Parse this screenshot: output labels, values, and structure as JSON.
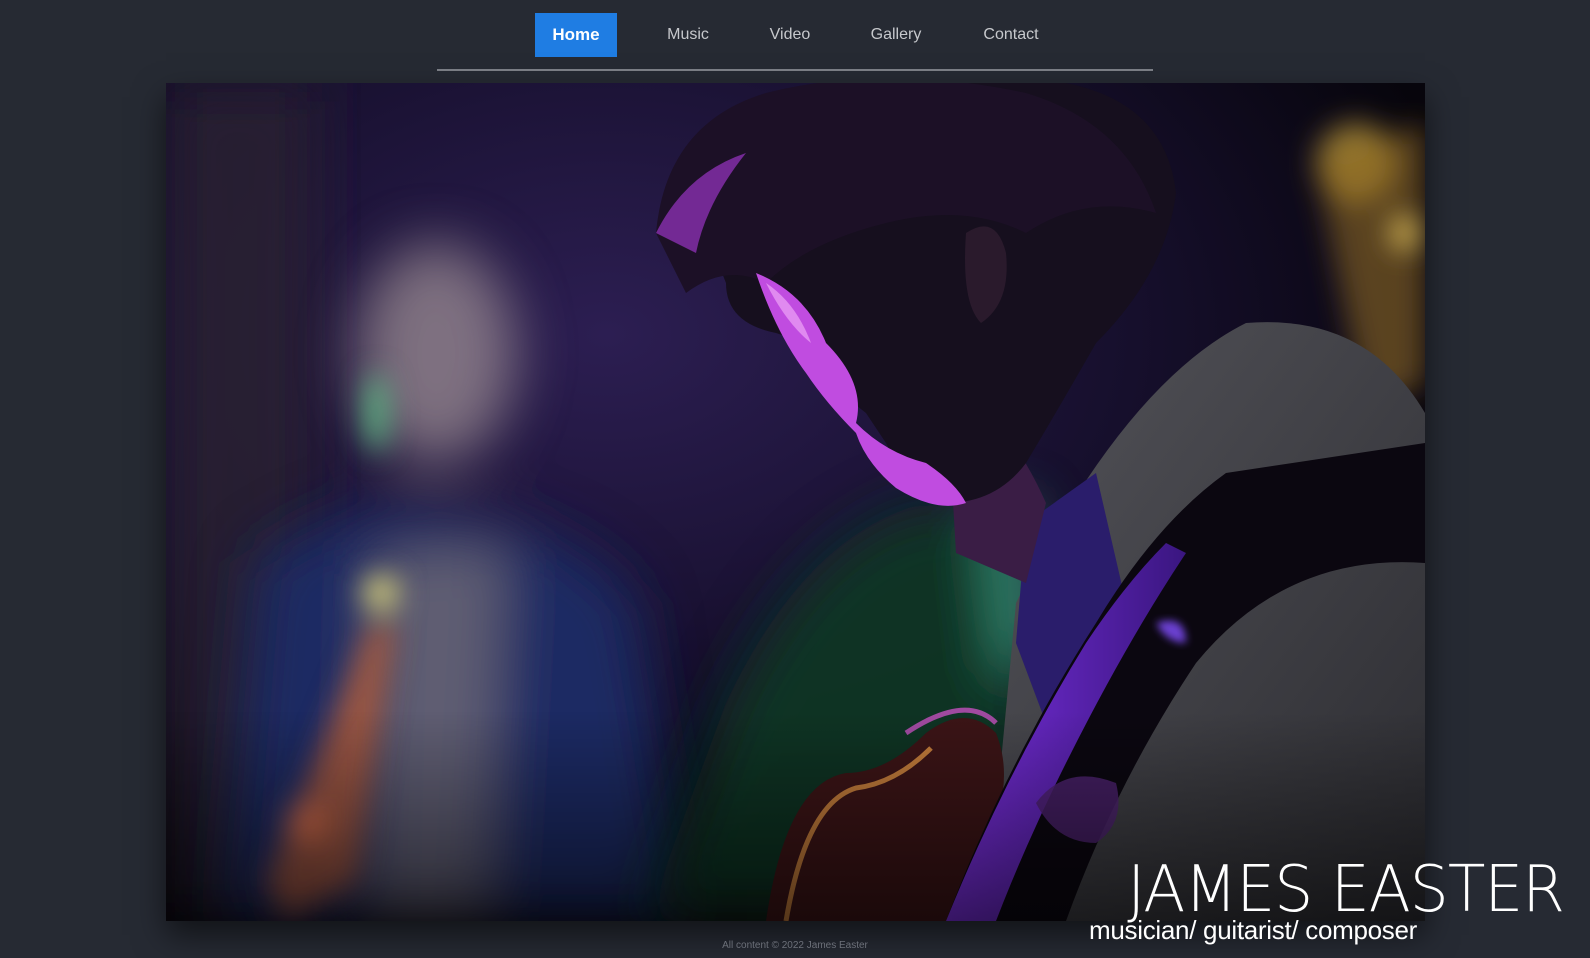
{
  "nav": {
    "items": [
      {
        "label": "Home",
        "active": true
      },
      {
        "label": "Music",
        "active": false
      },
      {
        "label": "Video",
        "active": false
      },
      {
        "label": "Gallery",
        "active": false
      },
      {
        "label": "Contact",
        "active": false
      }
    ]
  },
  "hero": {
    "name": "JAMES EASTER",
    "tagline": "musician/ guitarist/ composer"
  },
  "footer": {
    "text": "All content © 2022 James Easter"
  },
  "colors": {
    "background": "#262a33",
    "accent": "#1f7de3",
    "nav_text": "#c6c8cc",
    "divider": "#7d8088"
  }
}
